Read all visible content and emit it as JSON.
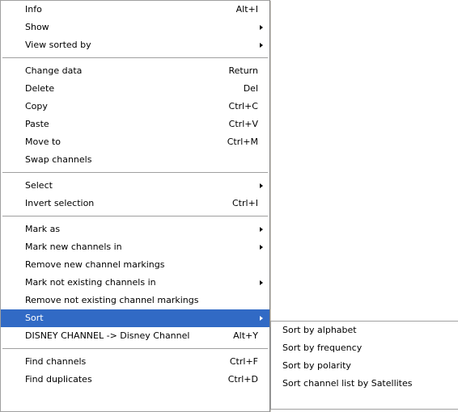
{
  "main_menu": {
    "info": {
      "label": "Info",
      "shortcut": "Alt+I"
    },
    "show": {
      "label": "Show"
    },
    "view_sorted_by": {
      "label": "View sorted by"
    },
    "change_data": {
      "label": "Change data",
      "shortcut": "Return"
    },
    "delete": {
      "label": "Delete",
      "shortcut": "Del"
    },
    "copy": {
      "label": "Copy",
      "shortcut": "Ctrl+C"
    },
    "paste": {
      "label": "Paste",
      "shortcut": "Ctrl+V"
    },
    "move_to": {
      "label": "Move to",
      "shortcut": "Ctrl+M"
    },
    "swap_channels": {
      "label": "Swap channels"
    },
    "select": {
      "label": "Select"
    },
    "invert_selection": {
      "label": "Invert selection",
      "shortcut": "Ctrl+I"
    },
    "mark_as": {
      "label": "Mark as"
    },
    "mark_new_channels_in": {
      "label": "Mark new channels in"
    },
    "remove_new_channel_markings": {
      "label": "Remove new channel markings"
    },
    "mark_not_existing_channels_in": {
      "label": "Mark not existing channels in"
    },
    "remove_not_existing_channel_markings": {
      "label": "Remove not existing channel markings"
    },
    "sort": {
      "label": "Sort"
    },
    "rename_channel": {
      "label": "DISNEY CHANNEL -> Disney Channel",
      "shortcut": "Alt+Y"
    },
    "find_channels": {
      "label": "Find channels",
      "shortcut": "Ctrl+F"
    },
    "find_duplicates": {
      "label": "Find duplicates",
      "shortcut": "Ctrl+D"
    }
  },
  "sort_submenu": {
    "sort_by_alphabet": {
      "label": "Sort by alphabet"
    },
    "sort_by_frequency": {
      "label": "Sort by frequency"
    },
    "sort_by_polarity": {
      "label": "Sort by polarity"
    },
    "sort_by_satellites": {
      "label": "Sort channel list by Satellites"
    }
  },
  "colors": {
    "highlight": "#316ac5",
    "highlight_text": "#ffffff",
    "menu_background": "#ffffff",
    "border": "#a0a0a0"
  },
  "icons": {
    "submenu_arrow": "submenu-arrow-icon"
  }
}
